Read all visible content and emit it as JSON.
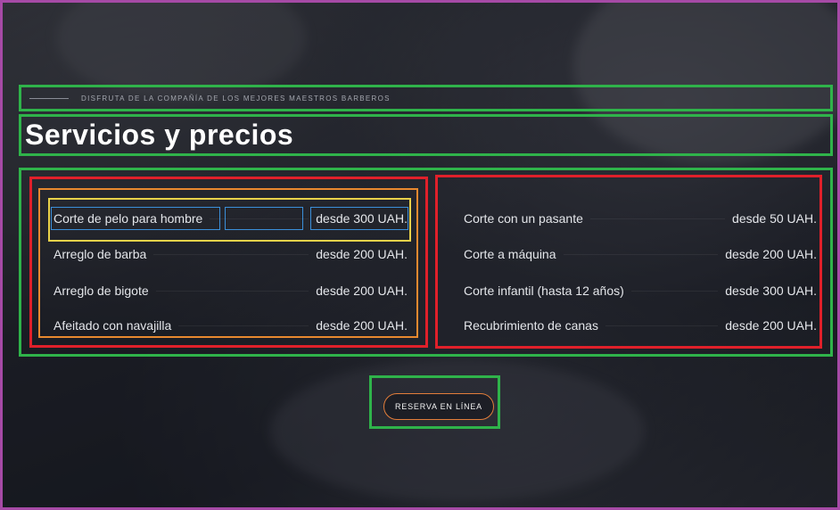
{
  "section": {
    "tagline": "DISFRUTA DE LA COMPAÑÍA DE LOS MEJORES MAESTROS BARBEROS",
    "title": "Servicios y precios"
  },
  "services_left": [
    {
      "name": "Corte de pelo para hombre",
      "price": "desde 300 UAH."
    },
    {
      "name": "Arreglo de barba",
      "price": "desde 200 UAH."
    },
    {
      "name": "Arreglo de bigote",
      "price": "desde 200 UAH."
    },
    {
      "name": "Afeitado con navajilla",
      "price": "desde 200 UAH."
    }
  ],
  "services_right": [
    {
      "name": "Corte con un pasante",
      "price": "desde 50 UAH."
    },
    {
      "name": "Corte a máquina",
      "price": "desde 200 UAH."
    },
    {
      "name": "Corte infantil (hasta 12 años)",
      "price": "desde 300 UAH."
    },
    {
      "name": "Recubrimiento de canas",
      "price": "desde 200 UAH."
    }
  ],
  "cta": {
    "label": "RESERVA EN LÍNEA"
  },
  "colors": {
    "accent": "#e27d3a",
    "text": "#e4e6ea",
    "frame": "#a64aa6"
  }
}
